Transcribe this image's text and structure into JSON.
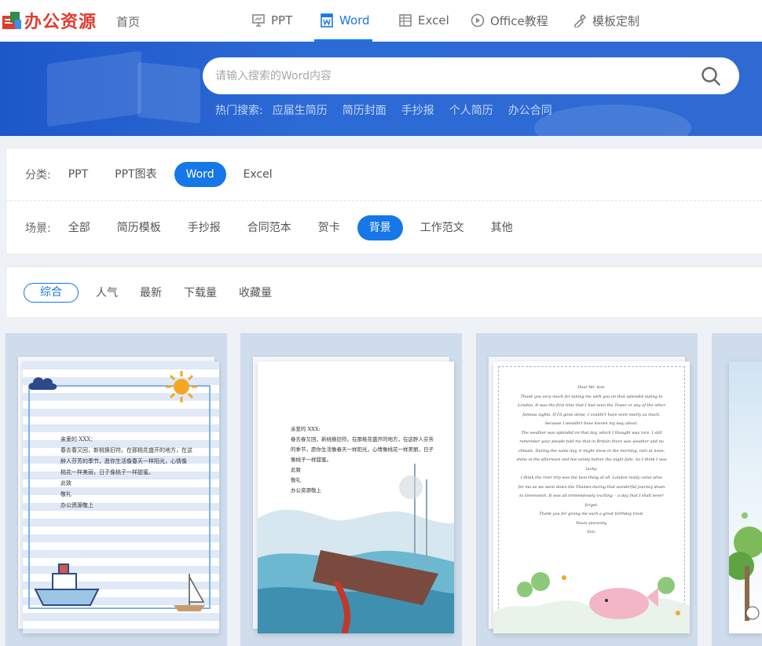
{
  "logo": {
    "text": "办公资源"
  },
  "nav": {
    "home": "首页",
    "items": [
      {
        "label": "PPT",
        "icon": "presentation-icon"
      },
      {
        "label": "Word",
        "icon": "word-icon",
        "active": true
      },
      {
        "label": "Excel",
        "icon": "excel-icon"
      },
      {
        "label": "Office教程",
        "icon": "play-circle-icon"
      },
      {
        "label": "模板定制",
        "icon": "design-tool-icon"
      }
    ]
  },
  "search": {
    "placeholder": "请输入搜索的Word内容",
    "hot_label": "热门搜索:",
    "hot_terms": [
      "应届生简历",
      "简历封面",
      "手抄报",
      "个人简历",
      "办公合同"
    ]
  },
  "filter": {
    "category_label": "分类:",
    "categories": [
      "PPT",
      "PPT图表",
      "Word",
      "Excel"
    ],
    "category_active": "Word",
    "scene_label": "场景:",
    "scenes": [
      "全部",
      "简历模板",
      "手抄报",
      "合同范本",
      "贺卡",
      "背景",
      "工作范文",
      "其他"
    ],
    "scene_active": "背景"
  },
  "sort": {
    "options": [
      "综合",
      "人气",
      "最新",
      "下载量",
      "收藏量"
    ],
    "active": "综合"
  },
  "cards": [
    {
      "lines": [
        "亲爱的 XXX：",
        "春去春又回，新桃换旧符。在那桃花盛开的地方，在这",
        "醉人芬芳的季节，愿你生活像春天一样阳光，心情像",
        "桃花一样美丽，日子像桃子一样甜蜜。",
        "此致",
        "敬礼",
        "办公资源敬上"
      ]
    },
    {
      "lines": [
        "亲爱的 XXX:",
        "春去春又回，新桃换旧符。在那桃花盛开的地方，在这醉人芬芳",
        "的季节，愿你生活像春天一样阳光，心情像桃花一样美丽，日子",
        "像桃子一样甜蜜。",
        "此致",
        "敬礼",
        "办公资源敬上"
      ]
    },
    {
      "lines": [
        "Dear Mr. lion:",
        "Thank you very much for taking me with you on that splendid outing to",
        "London. It was the first time that I had seen the Tower or any of the other",
        "famous sights. If I'd gone alone, I couldn't have seen nearly as much,",
        "because I wouldn't have known my way about.",
        "The weather was splendid on that day, which I thought was rare. I still",
        "remember your people told me that in Britain there was weather and no",
        "climate. During the same day, it might snow in the morning, rain at noon,",
        "shine in the afternoon and hot windy before the night falls. So I think I was",
        "lucky.",
        "I think the river trip was the best thing of all. London really came alive",
        "for me as we went down the Thames during that wonderful journey down",
        "to Greenwich. It was all tremendously exciting -- a day that I shall never",
        "forget.",
        "Thank you for giving me such a great birthday treat.",
        "Yours sincerely,",
        "lion."
      ]
    },
    {
      "lines": []
    }
  ],
  "colors": {
    "accent": "#1677e8",
    "banner": "#2c66d2",
    "brand": "#e23b2e"
  }
}
